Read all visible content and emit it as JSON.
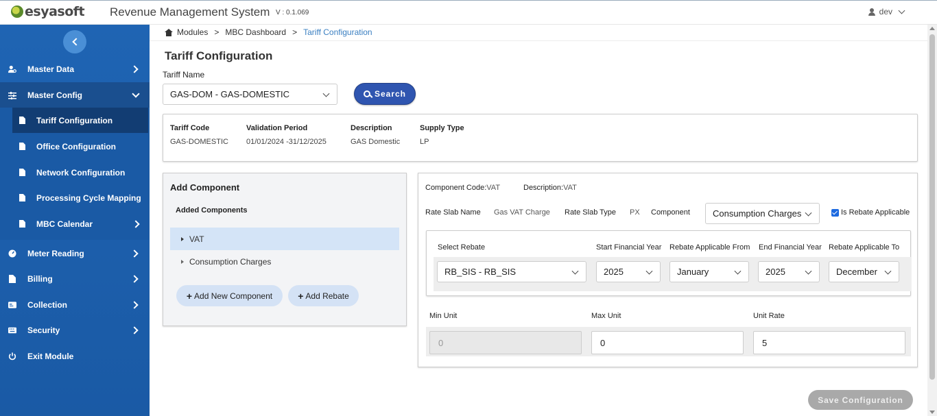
{
  "header": {
    "logo_text": "esyasoft",
    "app_title": "Revenue Management System",
    "version": "V : 0.1.069",
    "user": "dev"
  },
  "sidebar": {
    "items": [
      {
        "label": "Master Data",
        "icon": "user-gear-icon"
      },
      {
        "label": "Master Config",
        "icon": "sliders-icon"
      },
      {
        "label": "Meter Reading",
        "icon": "gauge-icon"
      },
      {
        "label": "Billing",
        "icon": "document-icon"
      },
      {
        "label": "Collection",
        "icon": "card-icon"
      },
      {
        "label": "Security",
        "icon": "keyboard-icon"
      },
      {
        "label": "Exit Module",
        "icon": "power-icon"
      }
    ],
    "sub_items": [
      {
        "label": "Tariff Configuration"
      },
      {
        "label": "Office Configuration"
      },
      {
        "label": "Network Configuration"
      },
      {
        "label": "Processing Cycle Mapping"
      },
      {
        "label": "MBC Calendar"
      }
    ]
  },
  "breadcrumb": {
    "items": [
      "Modules",
      "MBC Dashboard",
      "Tariff Configuration"
    ]
  },
  "page": {
    "title": "Tariff Configuration",
    "tariff_name_label": "Tariff Name",
    "tariff_name_value": "GAS-DOM - GAS-DOMESTIC",
    "search_label": "Search"
  },
  "info": {
    "tariff_code_label": "Tariff Code",
    "tariff_code_value": "GAS-DOMESTIC",
    "validation_label": "Validation Period",
    "validation_value": "01/01/2024 -31/12/2025",
    "description_label": "Description",
    "description_value": "GAS Domestic",
    "supply_label": "Supply Type",
    "supply_value": "LP"
  },
  "components": {
    "title": "Add Component",
    "subtitle": "Added Components",
    "list": [
      "VAT",
      "Consumption Charges"
    ],
    "add_component_label": "Add New Component",
    "add_rebate_label": "Add Rebate"
  },
  "detail": {
    "component_code_label": "Component Code:",
    "component_code_value": "VAT",
    "description_label": "Description:",
    "description_value": "VAT",
    "rate_slab_name_label": "Rate Slab Name",
    "rate_slab_name_value": "Gas VAT Charge",
    "rate_slab_type_label": "Rate Slab Type",
    "rate_slab_type_value": "PX",
    "component_label": "Component",
    "component_value": "Consumption Charges",
    "rebate_applicable_label": "Is Rebate Applicable",
    "rebate_headers": [
      "Select Rebate",
      "Start Financial Year",
      "Rebate Applicable From",
      "End Financial Year",
      "Rebate Applicable To"
    ],
    "rebate_values": {
      "select_rebate": "RB_SIS - RB_SIS",
      "start_year": "2025",
      "applicable_from": "January",
      "end_year": "2025",
      "applicable_to": "December"
    },
    "unit_headers": [
      "Min Unit",
      "Max Unit",
      "Unit Rate"
    ],
    "unit_values": {
      "min_unit": "0",
      "max_unit": "0",
      "unit_rate": "5"
    }
  },
  "footer": {
    "save_label": "Save Configuration"
  }
}
